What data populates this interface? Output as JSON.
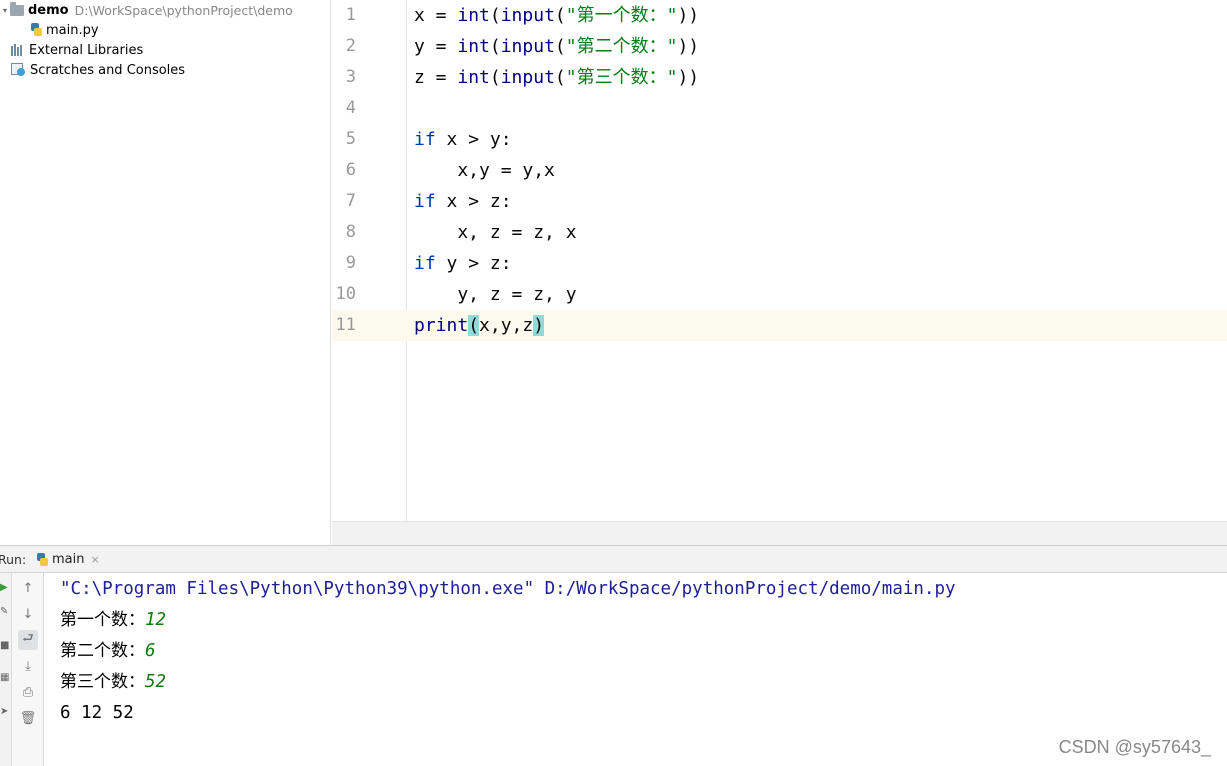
{
  "project_tree": {
    "root_name": "demo",
    "root_path": "D:\\WorkSpace\\pythonProject\\demo",
    "file": "main.py",
    "external_libraries": "External Libraries",
    "scratches": "Scratches and Consoles"
  },
  "editor": {
    "lines": [
      {
        "n": "1"
      },
      {
        "n": "2"
      },
      {
        "n": "3"
      },
      {
        "n": "4"
      },
      {
        "n": "5"
      },
      {
        "n": "6"
      },
      {
        "n": "7"
      },
      {
        "n": "8"
      },
      {
        "n": "9"
      },
      {
        "n": "10"
      },
      {
        "n": "11"
      }
    ],
    "code": {
      "l1": {
        "a": "x = ",
        "fn1": "int",
        "p1": "(",
        "fn2": "input",
        "p2": "(",
        "s": "\"第一个数：\"",
        "e": "))"
      },
      "l2": {
        "a": "y = ",
        "fn1": "int",
        "p1": "(",
        "fn2": "input",
        "p2": "(",
        "s": "\"第二个数：\"",
        "e": "))"
      },
      "l3": {
        "a": "z = ",
        "fn1": "int",
        "p1": "(",
        "fn2": "input",
        "p2": "(",
        "s": "\"第三个数：\"",
        "e": "))"
      },
      "l5": {
        "kw": "if",
        "rest": " x > y:"
      },
      "l6": {
        "rest": "    x,y = y,x"
      },
      "l7": {
        "kw": "if",
        "rest": " x > z:"
      },
      "l8": {
        "rest": "    x, z = z, x"
      },
      "l9": {
        "kw": "if",
        "rest": " y > z:"
      },
      "l10": {
        "rest": "    y, z = z, y"
      },
      "l11": {
        "fn": "print",
        "open": "(",
        "args": "x,y,z",
        "close": ")"
      }
    }
  },
  "run": {
    "label": "Run:",
    "tab_label": "main",
    "tab_close": "×",
    "console": {
      "command": "\"C:\\Program Files\\Python\\Python39\\python.exe\" D:/WorkSpace/pythonProject/demo/main.py",
      "prompt1": "第一个数：",
      "input1": "12",
      "prompt2": "第二个数：",
      "input2": "6",
      "prompt3": "第三个数：",
      "input3": "52",
      "output": "6 12 52"
    }
  },
  "watermark": "CSDN @sy57643_",
  "icons": {
    "folder": "folder-icon",
    "python_file": "python-file-icon",
    "libraries": "libraries-icon",
    "scratches": "scratches-icon",
    "rerun": "rerun-icon",
    "up": "arrow-up-icon",
    "down": "arrow-down-icon",
    "wrap": "soft-wrap-icon",
    "scroll_end": "scroll-to-end-icon",
    "print": "print-icon",
    "trash": "trash-icon"
  },
  "colors": {
    "keyword": "#0033b3",
    "string": "#067d17",
    "input_text": "#107c10",
    "command": "#1e1e96",
    "current_line": "#fcfaed",
    "brace_highlight": "#93d9d9"
  }
}
